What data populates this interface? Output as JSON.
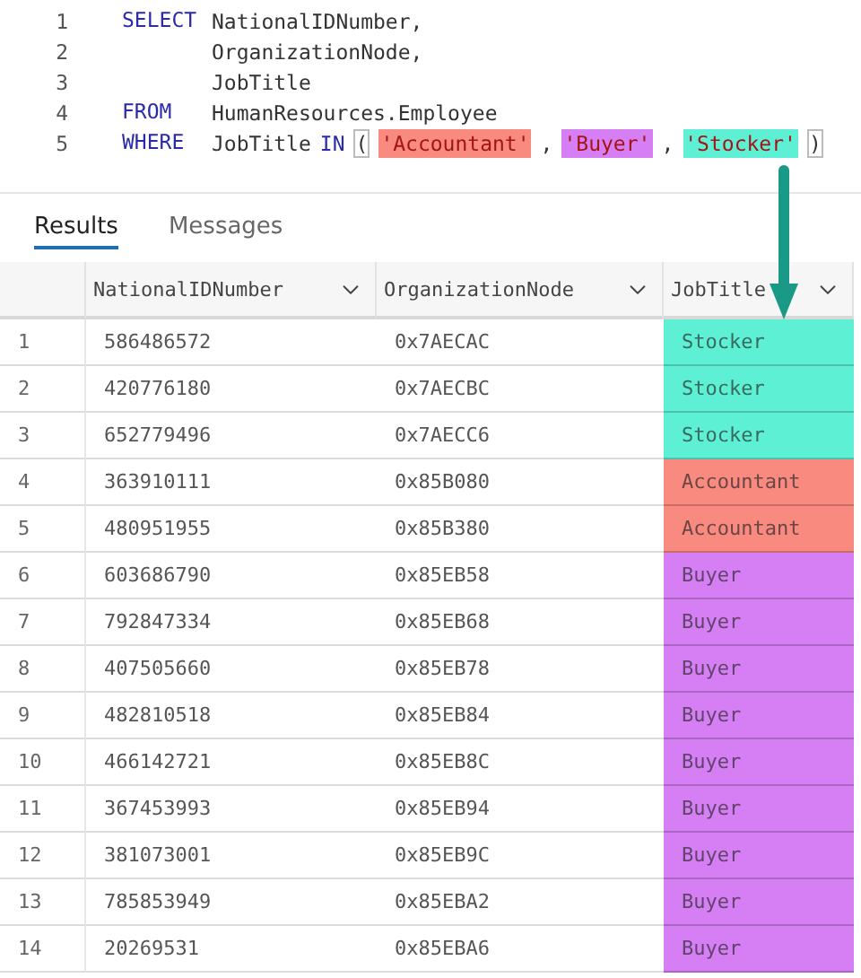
{
  "editor": {
    "lines": [
      {
        "number": "1",
        "keyword": "SELECT",
        "tokens": [
          {
            "kind": "plain",
            "text": "NationalIDNumber,"
          }
        ]
      },
      {
        "number": "2",
        "tokens": [
          {
            "kind": "plain",
            "text": "OrganizationNode,"
          }
        ]
      },
      {
        "number": "3",
        "tokens": [
          {
            "kind": "plain",
            "text": "JobTitle"
          }
        ]
      },
      {
        "number": "4",
        "keyword": "FROM",
        "tokens": [
          {
            "kind": "plain",
            "text": "HumanResources.Employee"
          }
        ]
      },
      {
        "number": "5",
        "keyword": "WHERE",
        "tokens": [
          {
            "kind": "plain",
            "text": "JobTitle"
          },
          {
            "kind": "keyword",
            "text": "IN"
          },
          {
            "kind": "bracket",
            "text": "("
          },
          {
            "kind": "string",
            "text": "'Accountant'",
            "color": "#f88a80"
          },
          {
            "kind": "plain",
            "text": ","
          },
          {
            "kind": "string",
            "text": "'Buyer'",
            "color": "#d67ff5"
          },
          {
            "kind": "plain",
            "text": ","
          },
          {
            "kind": "string",
            "text": "'Stocker'",
            "color": "#5ef0d4"
          },
          {
            "kind": "bracket",
            "text": ")"
          }
        ]
      }
    ]
  },
  "tabs": [
    {
      "label": "Results",
      "selected": true
    },
    {
      "label": "Messages",
      "selected": false
    }
  ],
  "table": {
    "columns": [
      "NationalIDNumber",
      "OrganizationNode",
      "JobTitle"
    ],
    "rows": [
      {
        "number": "1",
        "national_id": "586486572",
        "org_node": "0x7AECAC",
        "job_title": "Stocker",
        "color": "#5ef0d4"
      },
      {
        "number": "2",
        "national_id": "420776180",
        "org_node": "0x7AECBC",
        "job_title": "Stocker",
        "color": "#5ef0d4"
      },
      {
        "number": "3",
        "national_id": "652779496",
        "org_node": "0x7AECC6",
        "job_title": "Stocker",
        "color": "#5ef0d4"
      },
      {
        "number": "4",
        "national_id": "363910111",
        "org_node": "0x85B080",
        "job_title": "Accountant",
        "color": "#f88a80"
      },
      {
        "number": "5",
        "national_id": "480951955",
        "org_node": "0x85B380",
        "job_title": "Accountant",
        "color": "#f88a80"
      },
      {
        "number": "6",
        "national_id": "603686790",
        "org_node": "0x85EB58",
        "job_title": "Buyer",
        "color": "#d67ff5"
      },
      {
        "number": "7",
        "national_id": "792847334",
        "org_node": "0x85EB68",
        "job_title": "Buyer",
        "color": "#d67ff5"
      },
      {
        "number": "8",
        "national_id": "407505660",
        "org_node": "0x85EB78",
        "job_title": "Buyer",
        "color": "#d67ff5"
      },
      {
        "number": "9",
        "national_id": "482810518",
        "org_node": "0x85EB84",
        "job_title": "Buyer",
        "color": "#d67ff5"
      },
      {
        "number": "10",
        "national_id": "466142721",
        "org_node": "0x85EB8C",
        "job_title": "Buyer",
        "color": "#d67ff5"
      },
      {
        "number": "11",
        "national_id": "367453993",
        "org_node": "0x85EB94",
        "job_title": "Buyer",
        "color": "#d67ff5"
      },
      {
        "number": "12",
        "national_id": "381073001",
        "org_node": "0x85EB9C",
        "job_title": "Buyer",
        "color": "#d67ff5"
      },
      {
        "number": "13",
        "national_id": "785853949",
        "org_node": "0x85EBA2",
        "job_title": "Buyer",
        "color": "#d67ff5"
      },
      {
        "number": "14",
        "national_id": "20269531",
        "org_node": "0x85EBA6",
        "job_title": "Buyer",
        "color": "#d67ff5"
      }
    ]
  }
}
